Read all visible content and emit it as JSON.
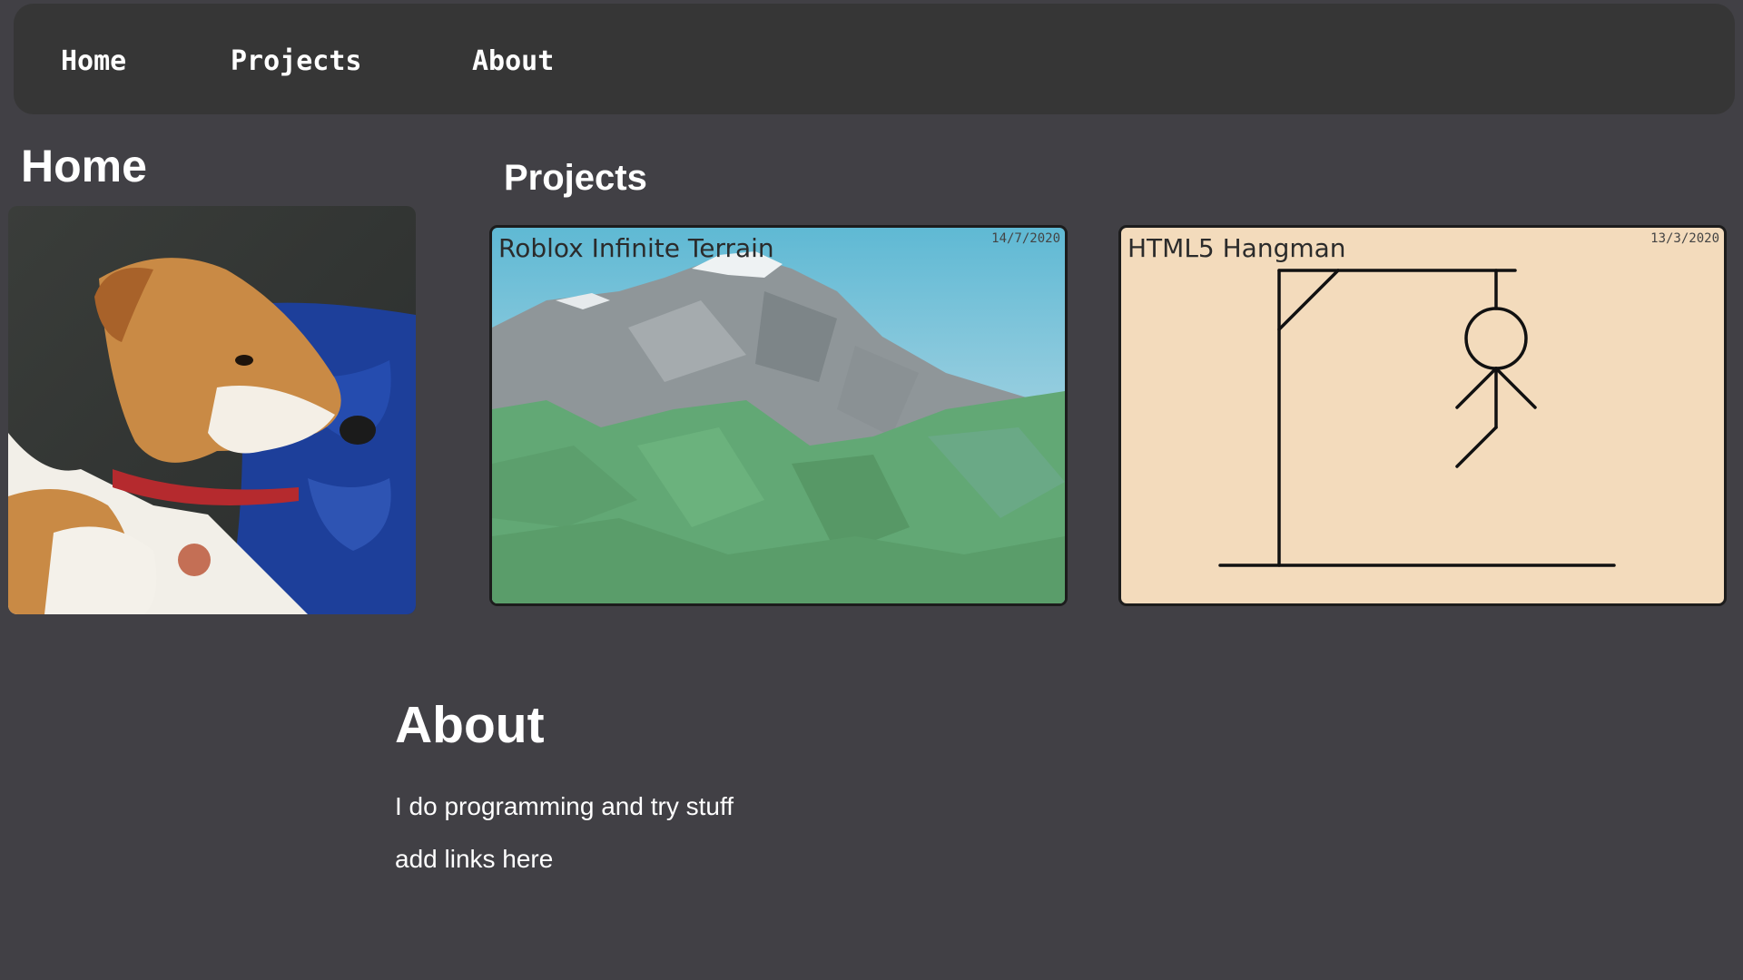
{
  "nav": {
    "home": "Home",
    "projects": "Projects",
    "about": "About"
  },
  "home": {
    "heading": "Home"
  },
  "projects": {
    "heading": "Projects",
    "items": [
      {
        "title": "Roblox Infinite Terrain",
        "date": "14/7/2020"
      },
      {
        "title": "HTML5 Hangman",
        "date": "13/3/2020"
      }
    ]
  },
  "about": {
    "heading": "About",
    "lines": [
      "I do programming and try stuff",
      "add links here"
    ]
  },
  "colors": {
    "background": "#414045",
    "navbar": "#363636",
    "hangman_card": "#f3dbbc"
  }
}
